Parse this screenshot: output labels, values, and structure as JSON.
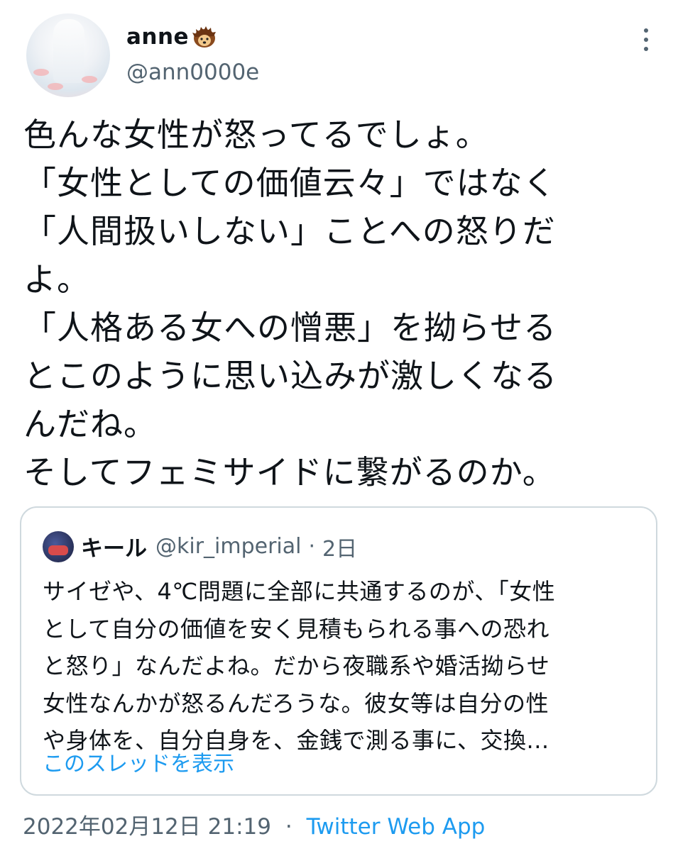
{
  "author": {
    "display_name": "anne",
    "badge_emoji": "hedgehog-emoji",
    "handle": "@ann0000e"
  },
  "tweet": {
    "lines": [
      "色んな女性が怒ってるでしょ。",
      "「女性としての価値云々」ではなく",
      "「人間扱いしない」ことへの怒りだ",
      "よ。",
      "「人格ある女への憎悪」を拗らせる",
      "とこのように思い込みが激しくなる",
      "んだね。",
      "そしてフェミサイドに繋がるのか。"
    ]
  },
  "quote": {
    "display_name": "キール",
    "handle": "@kir_imperial",
    "separator": "·",
    "time": "2日",
    "lines": [
      "サイゼや、4℃問題に全部に共通するのが、「女性",
      "として自分の価値を安く見積もられる事への恐れ",
      "と怒り」なんだよね。だから夜職系や婚活拗らせ",
      "女性なんかが怒るんだろうな。彼女等は自分の性",
      "や身体を、自分自身を、金銭で測る事に、交換..."
    ],
    "thread_link": "このスレッドを表示"
  },
  "meta": {
    "date": "2022年02月12日 21:19",
    "separator": "·",
    "source": "Twitter Web App"
  },
  "colors": {
    "text": "#0f1419",
    "secondary": "#536471",
    "link": "#1d9bf0",
    "border": "#cfd9de"
  }
}
